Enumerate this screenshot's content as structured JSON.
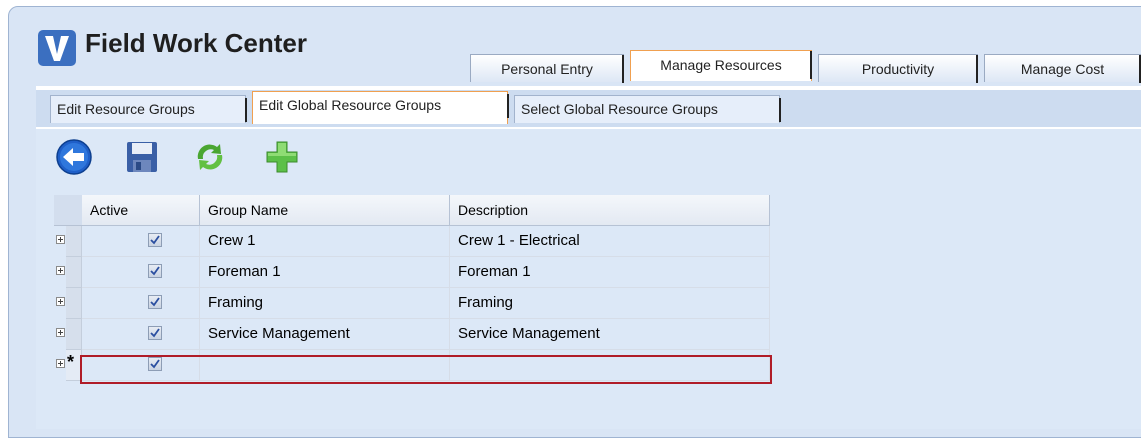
{
  "app": {
    "title": "Field Work Center",
    "logo_letter": "V",
    "accent_color": "#3b6fc0",
    "active_tab_border_color": "#f0a050",
    "new_row_outline_color": "#b01c28"
  },
  "top_tabs": [
    {
      "label": "Personal Entry",
      "active": false
    },
    {
      "label": "Manage Resources",
      "active": true
    },
    {
      "label": "Productivity",
      "active": false
    },
    {
      "label": "Manage Cost",
      "active": false
    }
  ],
  "sub_tabs": [
    {
      "label": "Edit Resource Groups",
      "active": false
    },
    {
      "label": "Edit Global Resource Groups",
      "active": true
    },
    {
      "label": "Select Global Resource Groups",
      "active": false
    }
  ],
  "toolbar": {
    "icons": [
      "back-arrow-icon",
      "save-icon",
      "refresh-icon",
      "add-icon"
    ]
  },
  "grid": {
    "columns": [
      "Active",
      "Group Name",
      "Description"
    ],
    "rows": [
      {
        "active": true,
        "group_name": "Crew 1",
        "description": "Crew 1 - Electrical"
      },
      {
        "active": true,
        "group_name": "Foreman 1",
        "description": "Foreman 1"
      },
      {
        "active": true,
        "group_name": "Framing",
        "description": "Framing"
      },
      {
        "active": true,
        "group_name": "Service Management",
        "description": "Service Management"
      }
    ],
    "new_row": {
      "marker": "*",
      "active": true,
      "group_name": "",
      "description": ""
    }
  }
}
